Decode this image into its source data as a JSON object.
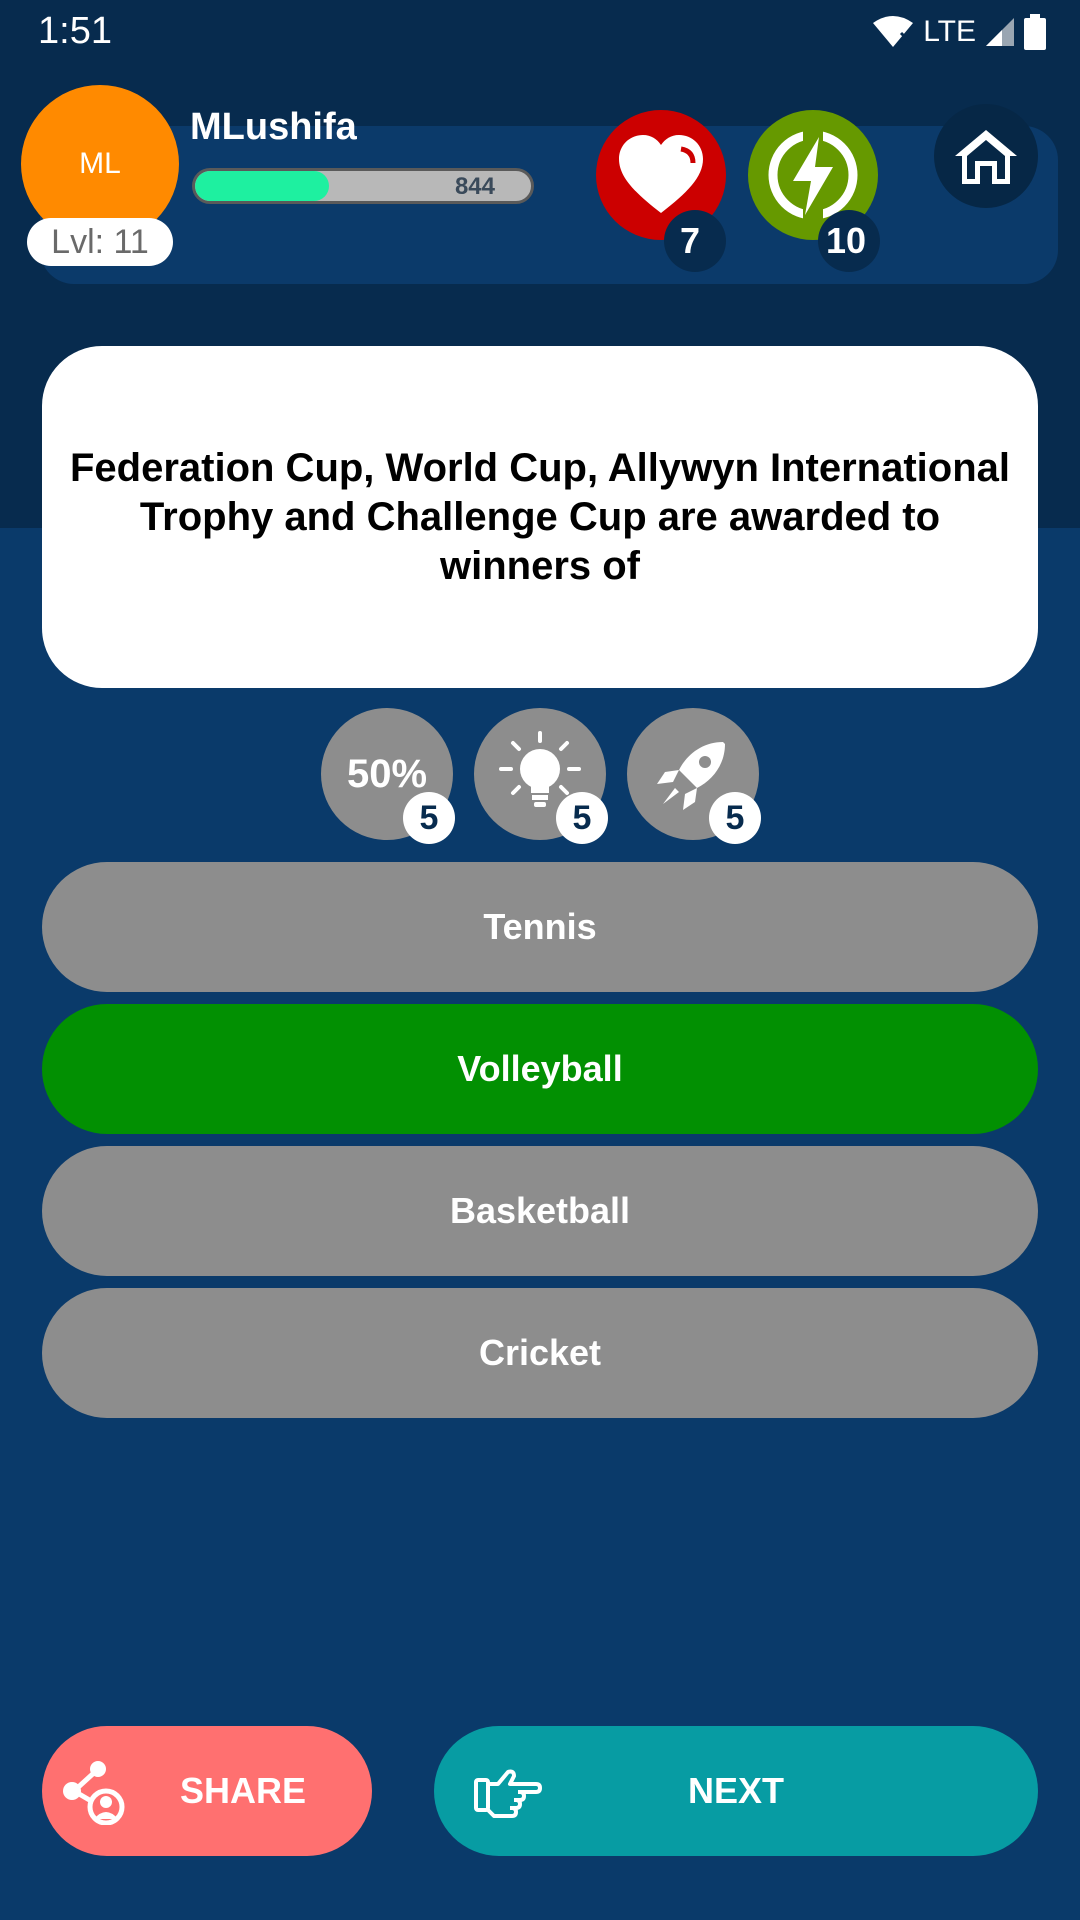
{
  "status_bar": {
    "time": "1:51",
    "network": "LTE"
  },
  "player": {
    "avatar_initials": "ML",
    "name": "MLushifa",
    "level": "Lvl: 11",
    "xp_value": "844",
    "xp_fraction": 0.4
  },
  "stats": {
    "hearts": "7",
    "energy": "10"
  },
  "question": {
    "text": "Federation Cup, World Cup, Allywyn International Trophy and Challenge Cup are awarded to winners of"
  },
  "lifelines": {
    "fifty_label": "50%",
    "fifty_count": "5",
    "hint_count": "5",
    "skip_count": "5"
  },
  "answers": [
    {
      "label": "Tennis",
      "state": "neutral"
    },
    {
      "label": "Volleyball",
      "state": "correct"
    },
    {
      "label": "Basketball",
      "state": "neutral"
    },
    {
      "label": "Cricket",
      "state": "neutral"
    }
  ],
  "actions": {
    "share_label": "SHARE",
    "next_label": "NEXT"
  },
  "colors": {
    "background": "#0a3a6a",
    "header_bg": "#072b4e",
    "avatar": "#ff8a00",
    "xp_fill": "#1ef0a0",
    "hearts": "#cc0000",
    "energy": "#669900",
    "answer_neutral": "#8d8d8d",
    "answer_correct": "#029002",
    "share": "#ff7070",
    "next": "#079ca3"
  },
  "icons": {
    "hearts": "heart-icon",
    "energy": "lightning-icon",
    "home": "home-icon",
    "hint": "lightbulb-icon",
    "skip": "rocket-icon",
    "share": "share-icon",
    "next": "pointing-hand-icon"
  }
}
